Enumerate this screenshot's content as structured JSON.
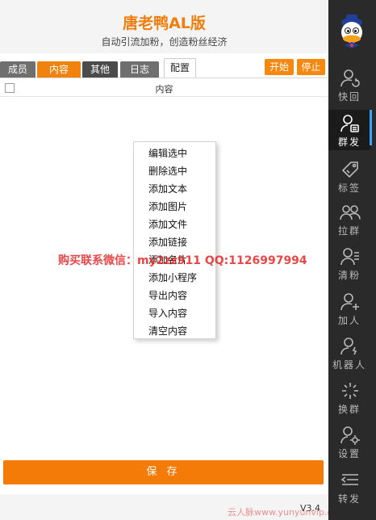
{
  "header": {
    "title": "唐老鸭AL版",
    "subtitle": "自动引流加粉，创造粉丝经济"
  },
  "tabs": [
    {
      "label": "成员"
    },
    {
      "label": "内容"
    },
    {
      "label": "其他"
    },
    {
      "label": "日志"
    },
    {
      "label": "配置"
    }
  ],
  "toolbar": {
    "start_label": "开始",
    "stop_label": "停止"
  },
  "table": {
    "column_header": "内容"
  },
  "context_menu": {
    "items": [
      "编辑选中",
      "删除选中",
      "添加文本",
      "添加图片",
      "添加文件",
      "添加链接",
      "添加名片",
      "添加小程序",
      "导出内容",
      "导入内容",
      "清空内容"
    ]
  },
  "save_label": "保 存",
  "version": "V3.4",
  "watermark": "购买联系微信：my2zz911   QQ:1126997994",
  "bottom_watermark": "云人脉www.yunyunvip.com",
  "sidebar": {
    "items": [
      {
        "label": "快回",
        "icon": "user-refresh-icon"
      },
      {
        "label": "群发",
        "icon": "user-send-icon"
      },
      {
        "label": "标签",
        "icon": "tag-icon"
      },
      {
        "label": "拉群",
        "icon": "group-pull-icon"
      },
      {
        "label": "清粉",
        "icon": "user-clear-icon"
      },
      {
        "label": "加人",
        "icon": "user-add-icon"
      },
      {
        "label": "机器人",
        "icon": "robot-user-icon"
      },
      {
        "label": "换群",
        "icon": "group-switch-icon"
      },
      {
        "label": "设置",
        "icon": "user-settings-icon"
      },
      {
        "label": "转发",
        "icon": "forward-list-icon"
      }
    ]
  },
  "colors": {
    "accent": "#f47b08",
    "sidebar_bg": "#2a2a2a",
    "active_indicator": "#3aa4ff"
  }
}
